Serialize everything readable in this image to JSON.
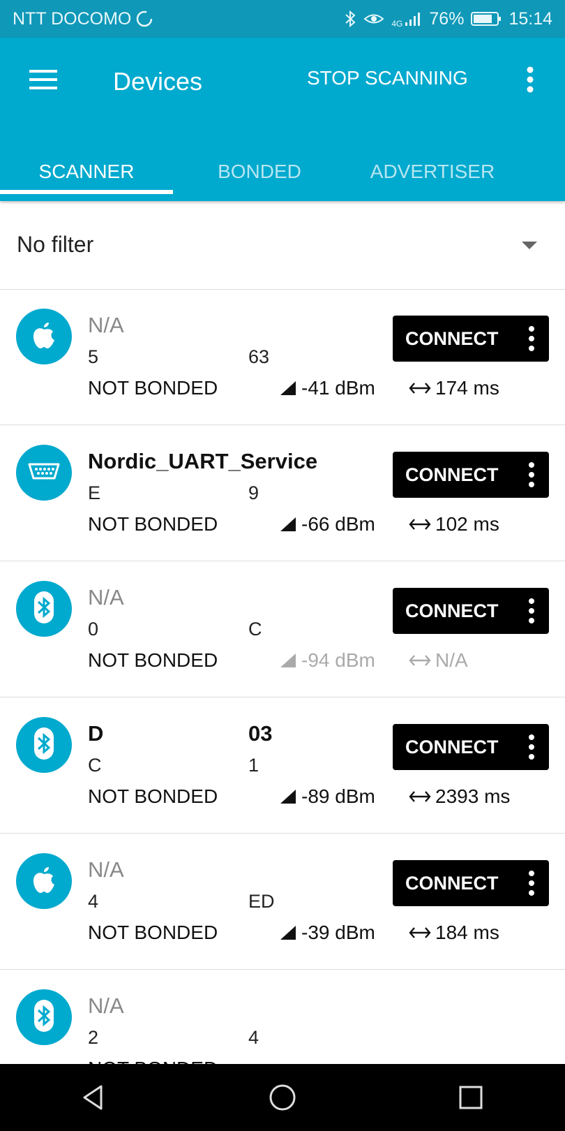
{
  "status_bar": {
    "carrier": "NTT DOCOMO",
    "network": "4G",
    "battery": "76%",
    "time": "15:14"
  },
  "app_bar": {
    "title": "Devices",
    "stop_scanning": "STOP SCANNING",
    "tabs": [
      {
        "label": "SCANNER",
        "active": true
      },
      {
        "label": "BONDED",
        "active": false
      },
      {
        "label": "ADVERTISER",
        "active": false
      }
    ]
  },
  "filter": {
    "selected": "No filter"
  },
  "connect_label": "CONNECT",
  "devices": [
    {
      "icon": "apple-icon",
      "name": "N/A",
      "named": false,
      "address_start": "5",
      "address_end": "63",
      "bond": "NOT BONDED",
      "rssi": "-41 dBm",
      "interval": "174 ms"
    },
    {
      "icon": "serial-port-icon",
      "name": "Nordic_UART_Service",
      "named": true,
      "address_start": "E",
      "address_end": "9",
      "bond": "NOT BONDED",
      "rssi": "-66 dBm",
      "interval": "102 ms"
    },
    {
      "icon": "bluetooth-icon",
      "name": "N/A",
      "named": false,
      "address_start": "0",
      "address_end": "C",
      "bond": "NOT BONDED",
      "rssi": "-94 dBm",
      "interval": "N/A",
      "faded": true
    },
    {
      "icon": "bluetooth-icon",
      "name": "D",
      "name_end": "03",
      "named": true,
      "address_start": "C",
      "address_end": "1",
      "bond": "NOT BONDED",
      "rssi": "-89 dBm",
      "interval": "2393 ms"
    },
    {
      "icon": "apple-icon",
      "name": "N/A",
      "named": false,
      "address_start": "4",
      "address_end": "ED",
      "bond": "NOT BONDED",
      "rssi": "-39 dBm",
      "interval": "184 ms"
    },
    {
      "icon": "bluetooth-icon",
      "name": "N/A",
      "named": false,
      "address_start": "2",
      "address_end": "4",
      "bond": "NOT BONDED",
      "rssi": "",
      "interval": ""
    }
  ],
  "colors": {
    "status_bar": "#0f98b8",
    "app_bar": "#00a9ce",
    "connect_button": "#000000",
    "nav_bar": "#000000"
  }
}
